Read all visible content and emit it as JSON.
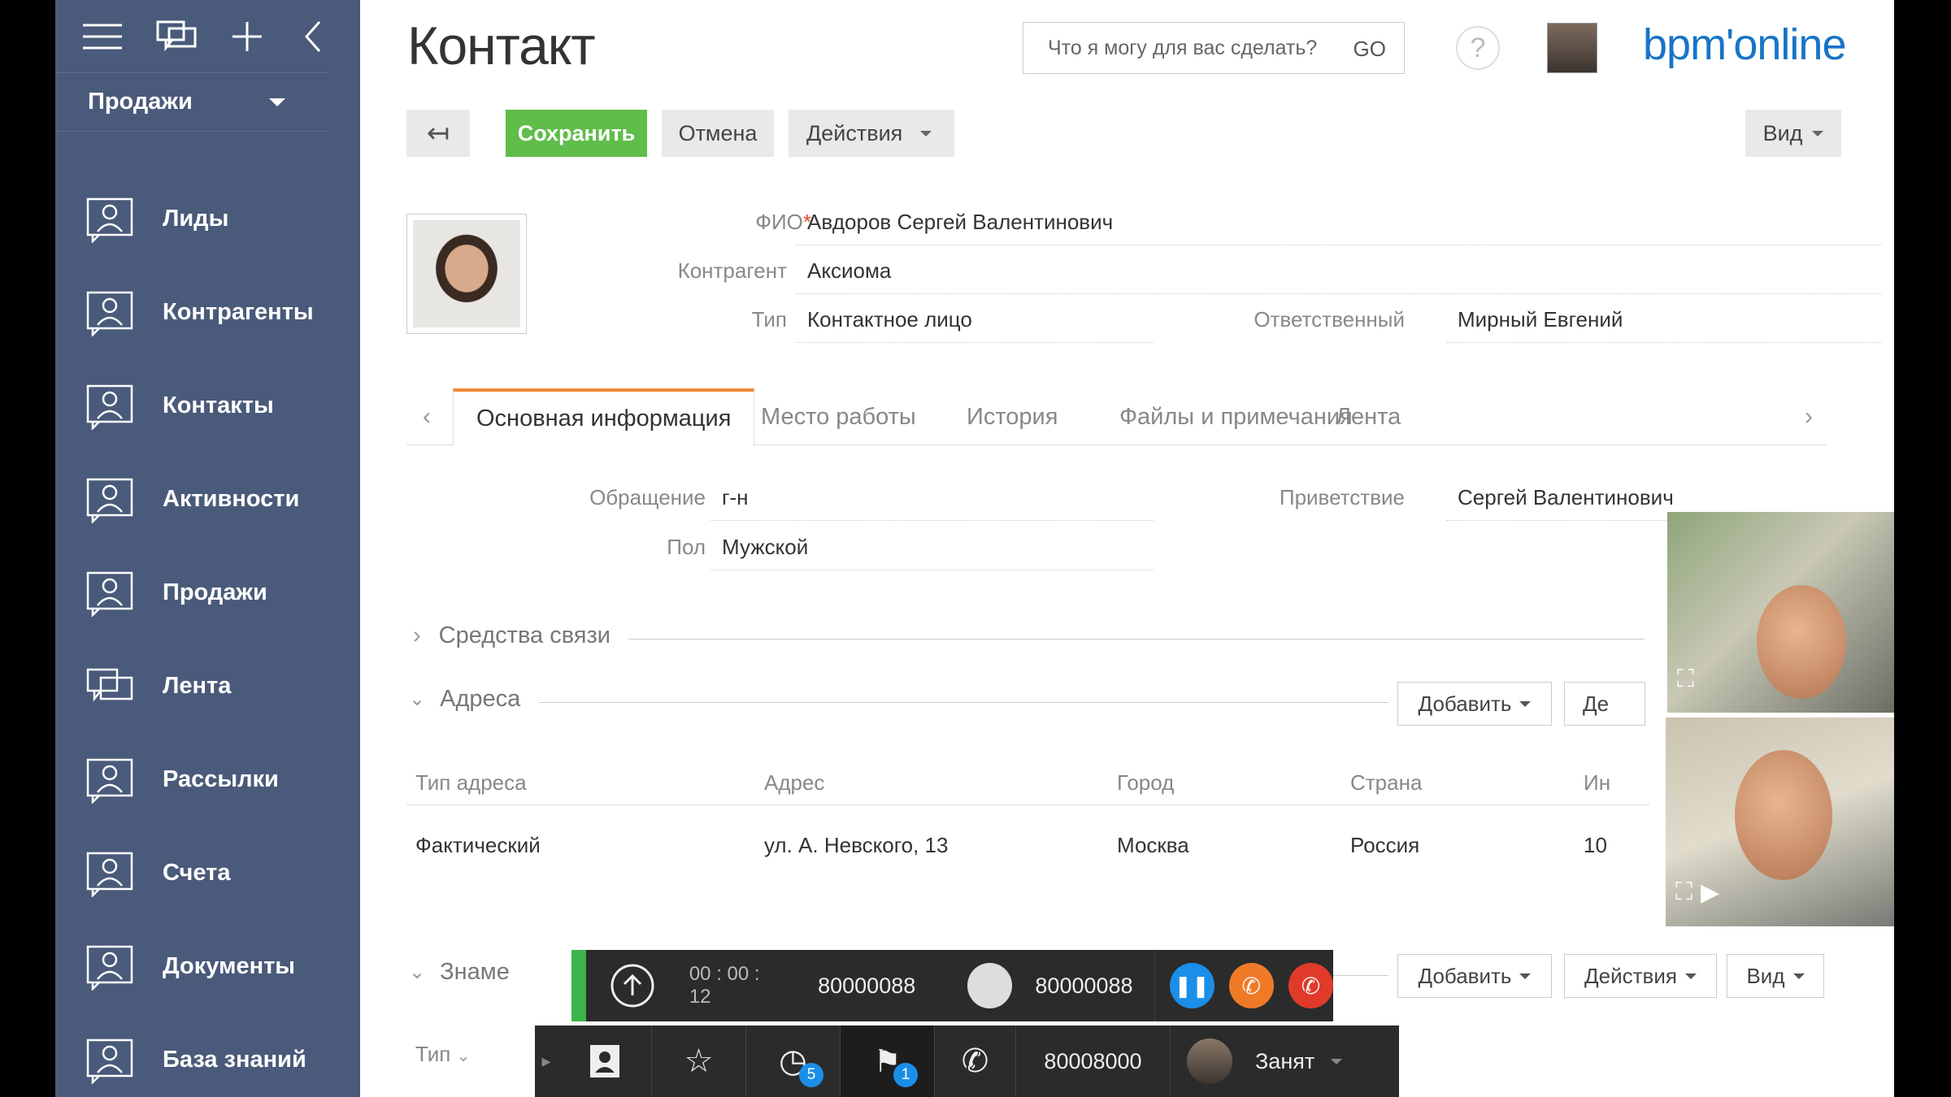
{
  "sidebar": {
    "workplace": "Продажи",
    "items": [
      {
        "label": "Лиды",
        "icon": "contact-card-icon"
      },
      {
        "label": "Контрагенты",
        "icon": "contact-card-icon"
      },
      {
        "label": "Контакты",
        "icon": "contact-card-icon"
      },
      {
        "label": "Активности",
        "icon": "contact-card-icon"
      },
      {
        "label": "Продажи",
        "icon": "contact-card-icon"
      },
      {
        "label": "Лента",
        "icon": "chat-bubbles-icon"
      },
      {
        "label": "Рассылки",
        "icon": "contact-card-icon"
      },
      {
        "label": "Счета",
        "icon": "contact-card-icon"
      },
      {
        "label": "Документы",
        "icon": "contact-card-icon"
      },
      {
        "label": "База знаний",
        "icon": "contact-card-icon"
      }
    ]
  },
  "header": {
    "title": "Контакт",
    "search_placeholder": "Что я могу для вас сделать?",
    "go_label": "GO",
    "help": "?",
    "logo": "bpm'online"
  },
  "toolbar": {
    "back": "↤",
    "save": "Сохранить",
    "cancel": "Отмена",
    "actions": "Действия",
    "view": "Вид"
  },
  "contact": {
    "fio_label": "ФИО",
    "fio_value": "Авдоров Сергей Валентинович",
    "account_label": "Контрагент",
    "account_value": "Аксиома",
    "type_label": "Тип",
    "type_value": "Контактное лицо",
    "owner_label": "Ответственный",
    "owner_value": "Мирный Евгений"
  },
  "tabs": [
    "Основная информация",
    "Место работы",
    "История",
    "Файлы и примечания",
    "Лента"
  ],
  "general": {
    "salutation_label": "Обращение",
    "salutation_value": "г-н",
    "gender_label": "Пол",
    "gender_value": "Мужской",
    "greeting_label": "Приветствие",
    "greeting_value": "Сергей Валентинович"
  },
  "sections": {
    "communication": "Средства связи",
    "addresses": "Адреса",
    "anniversaries": "Знаме",
    "add": "Добавить",
    "actions_partial": "Де",
    "actions": "Действия",
    "view": "Вид"
  },
  "address_table": {
    "headers": [
      "Тип адреса",
      "Адрес",
      "Город",
      "Страна",
      "Ин"
    ],
    "rows": [
      [
        "Фактический",
        "ул. А. Невского, 13",
        "Москва",
        "Россия",
        "10"
      ]
    ]
  },
  "anniv_table": {
    "header_type": "Тип"
  },
  "call": {
    "timer": "00 : 00 : 12",
    "number_in": "80000088",
    "number_out": "80000088"
  },
  "bottom": {
    "history_badge": "5",
    "flag_badge": "1",
    "phone_number": "80008000",
    "status": "Занят"
  },
  "colors": {
    "sidebar": "#4a5a7a",
    "save": "#5fbd4a",
    "accent_tab": "#f08a33",
    "logo": "#1874c6"
  }
}
